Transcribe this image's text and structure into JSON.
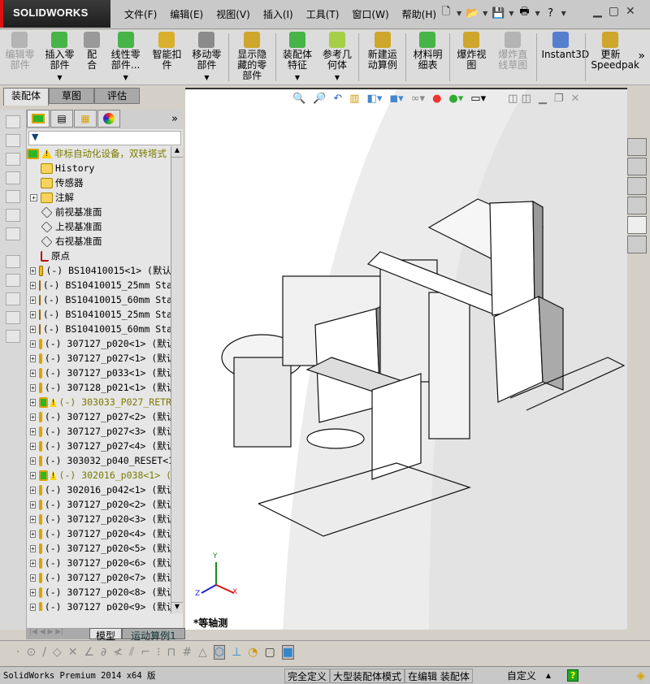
{
  "app": {
    "brand": "SOLIDWORKS",
    "accent": "#d11a1a"
  },
  "menu": [
    "文件(F)",
    "编辑(E)",
    "视图(V)",
    "插入(I)",
    "工具(T)",
    "窗口(W)",
    "帮助(H)"
  ],
  "quick_access": [
    "new-icon",
    "open-icon",
    "save-icon",
    "print-icon",
    "help-icon"
  ],
  "window_controls": [
    "minimize",
    "maximize",
    "close"
  ],
  "commands": [
    {
      "label": "编辑零部件",
      "disabled": true
    },
    {
      "label": "插入零部件",
      "dropdown": true
    },
    {
      "label": "配合"
    },
    {
      "label": "线性零部件...",
      "dropdown": true
    },
    {
      "label": "智能扣件"
    },
    {
      "label": "移动零部件",
      "dropdown": true
    },
    {
      "label": "显示隐藏的零部件"
    },
    {
      "label": "装配体特征",
      "dropdown": true
    },
    {
      "label": "参考几何体",
      "dropdown": true
    },
    {
      "label": "新建运动算例"
    },
    {
      "label": "材料明细表"
    },
    {
      "label": "爆炸视图"
    },
    {
      "label": "爆炸直线草图",
      "disabled": true
    },
    {
      "label": "Instant3D"
    },
    {
      "label": "更新Speedpak"
    }
  ],
  "more": "»",
  "tabs": [
    {
      "label": "装配体",
      "active": true
    },
    {
      "label": "草图"
    },
    {
      "label": "评估"
    }
  ],
  "fm_more": "»",
  "filter_icon": "filter-icon",
  "tree": [
    {
      "label": "非标自动化设备，双转塔式",
      "icon": "assembly",
      "warn": true,
      "root": true
    },
    {
      "label": "History",
      "icon": "folder"
    },
    {
      "label": "传感器",
      "icon": "folder"
    },
    {
      "label": "注解",
      "icon": "folder",
      "expand": true
    },
    {
      "label": "前视基准面",
      "icon": "plane"
    },
    {
      "label": "上视基准面",
      "icon": "plane"
    },
    {
      "label": "右视基准面",
      "icon": "plane"
    },
    {
      "label": "原点",
      "icon": "origin"
    },
    {
      "label": "(-) BS10410015<1> (默认",
      "icon": "part",
      "expand": true
    },
    {
      "label": "(-) BS10410015_25mm Sta",
      "icon": "part",
      "expand": true
    },
    {
      "label": "(-) BS10410015_60mm Sta",
      "icon": "part",
      "expand": true
    },
    {
      "label": "(-) BS10410015_25mm Sta",
      "icon": "part",
      "expand": true
    },
    {
      "label": "(-) BS10410015_60mm Sta",
      "icon": "part",
      "expand": true
    },
    {
      "label": "(-) 307127_p020<1> (默认",
      "icon": "assembly",
      "expand": true
    },
    {
      "label": "(-) 307127_p027<1> (默认",
      "icon": "assembly",
      "expand": true
    },
    {
      "label": "(-) 307127_p033<1> (默认",
      "icon": "assembly",
      "expand": true
    },
    {
      "label": "(-) 307128_p021<1> (默认",
      "icon": "assembly",
      "expand": true
    },
    {
      "label": "(-) 303033_P027_RETR",
      "icon": "assembly",
      "expand": true,
      "warn": true
    },
    {
      "label": "(-) 307127_p027<2> (默认",
      "icon": "assembly",
      "expand": true
    },
    {
      "label": "(-) 307127_p027<3> (默认",
      "icon": "assembly",
      "expand": true
    },
    {
      "label": "(-) 307127_p027<4> (默认",
      "icon": "assembly",
      "expand": true
    },
    {
      "label": "(-) 303032_p040_RESET<1",
      "icon": "assembly",
      "expand": true
    },
    {
      "label": "(-) 302016_p038<1> (",
      "icon": "assembly",
      "expand": true,
      "warn": true
    },
    {
      "label": "(-) 302016_p042<1> (默认",
      "icon": "assembly",
      "expand": true
    },
    {
      "label": "(-) 307127_p020<2> (默认",
      "icon": "assembly",
      "expand": true
    },
    {
      "label": "(-) 307127_p020<3> (默认",
      "icon": "assembly",
      "expand": true
    },
    {
      "label": "(-) 307127_p020<4> (默认",
      "icon": "assembly",
      "expand": true
    },
    {
      "label": "(-) 307127_p020<5> (默认",
      "icon": "assembly",
      "expand": true
    },
    {
      "label": "(-) 307127_p020<6> (默认",
      "icon": "assembly",
      "expand": true
    },
    {
      "label": "(-) 307127_p020<7> (默认",
      "icon": "assembly",
      "expand": true
    },
    {
      "label": "(-) 307127_p020<8> (默认",
      "icon": "assembly",
      "expand": true
    },
    {
      "label": "(-) 307127_p020<9> (默认",
      "icon": "assembly",
      "expand": true
    }
  ],
  "bottom_tabs": [
    "模型",
    "运动算例1"
  ],
  "viewport": {
    "view_label": "*等轴测",
    "triad": {
      "x": "X",
      "y": "Y",
      "z": "Z"
    }
  },
  "hud_icons": [
    "zoom-to-fit-icon",
    "zoom-area-icon",
    "previous-view-icon",
    "section-view-icon",
    "view-orientation-icon",
    "display-style-icon",
    "hide-show-icon",
    "appearance-icon",
    "scene-icon",
    "view-settings-icon"
  ],
  "taskpane_icons": [
    "home-icon",
    "resources-icon",
    "file-explorer-icon",
    "view-palette-icon",
    "appearances-icon",
    "custom-properties-icon"
  ],
  "status": {
    "product": "SolidWorks Premium 2014 x64 版",
    "items": [
      "完全定义",
      "大型装配体模式",
      "在编辑 装配体"
    ],
    "custom": "自定义",
    "help": "?"
  }
}
